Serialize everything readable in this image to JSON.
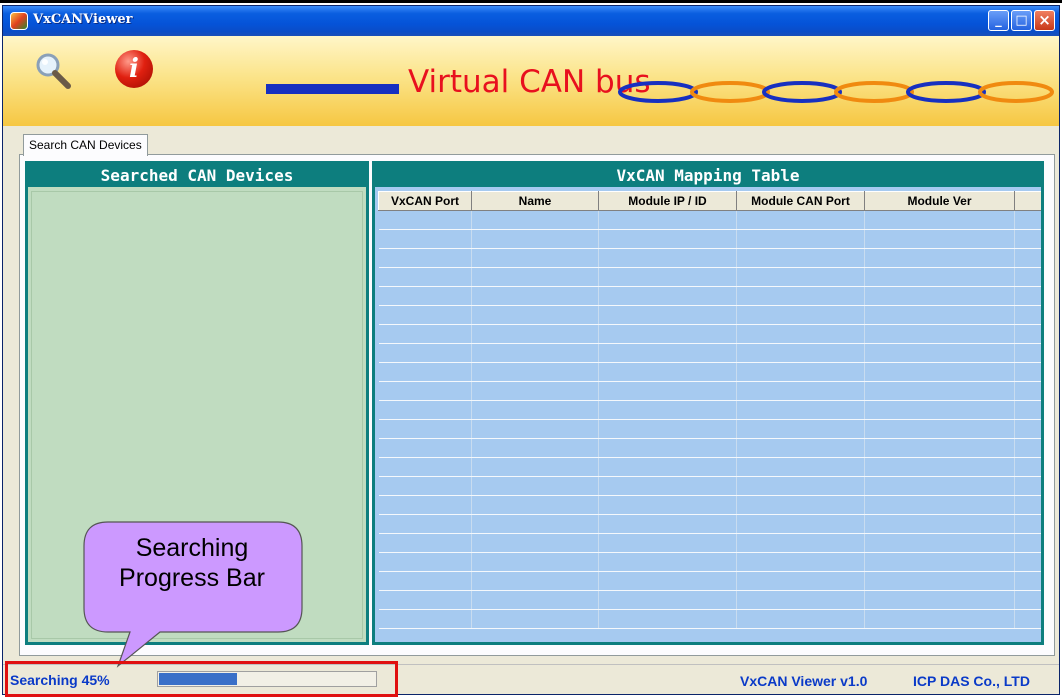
{
  "window": {
    "title": "VxCANViewer",
    "controls": {
      "minimize": "_",
      "maximize": "□",
      "close": "×"
    }
  },
  "banner": {
    "icons": [
      "search-icon",
      "info-icon"
    ],
    "info_glyph": "i",
    "title": "Virtual CAN bus",
    "title_color": "#e8101e",
    "bus_line_color": "#1730c0"
  },
  "tabs": [
    {
      "label": "Search CAN Devices",
      "active": true
    }
  ],
  "left_panel": {
    "title": "Searched CAN Devices",
    "header_color": "#0d7e7e",
    "items": []
  },
  "mapping_table": {
    "title": "VxCAN Mapping Table",
    "columns": [
      "VxCAN Port",
      "Name",
      "Module IP / ID",
      "Module CAN Port",
      "Module Ver"
    ],
    "rows": []
  },
  "status_bar": {
    "status_text": "Searching 45%",
    "progress_fraction": 0.36,
    "version": "VxCAN Viewer v1.0",
    "company": "ICP DAS Co., LTD"
  },
  "annotation": {
    "callout_line1": "Searching",
    "callout_line2": "Progress Bar",
    "callout_color": "#cc99ff",
    "highlight_color": "#e01010"
  }
}
